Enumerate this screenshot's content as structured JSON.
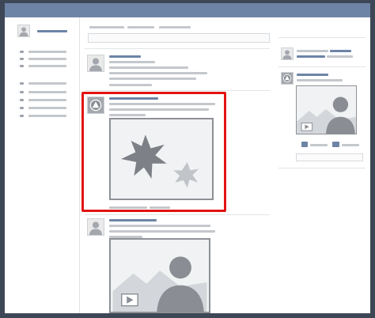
{
  "colors": {
    "brand": "#6d84a6",
    "highlight": "#e21313",
    "placeholder_text": "#c4c7cc",
    "media_background": "#f1f2f3"
  },
  "header": {
    "profile_icon": "user-icon"
  },
  "sidebar": {
    "items": [
      {
        "icon": "bullet-icon"
      },
      {
        "icon": "bullet-icon"
      },
      {
        "icon": "bullet-icon"
      },
      {
        "icon": "bullet-icon"
      },
      {
        "icon": "bullet-icon"
      },
      {
        "icon": "bullet-icon"
      },
      {
        "icon": "bullet-icon"
      }
    ]
  },
  "feed": {
    "posts": [
      {
        "avatar_icon": "user-icon",
        "media": "none"
      },
      {
        "avatar_icon": "page-logo-icon",
        "media": "starburst-image",
        "highlighted": true
      },
      {
        "avatar_icon": "user-icon",
        "media": "video-thumbnail"
      }
    ]
  },
  "right_column": {
    "widgets": [
      {
        "avatar_icon": "user-icon"
      },
      {
        "avatar_icon": "page-logo-icon",
        "media": "video-thumbnail",
        "actions": [
          "like-icon",
          "comment-icon"
        ]
      }
    ]
  }
}
